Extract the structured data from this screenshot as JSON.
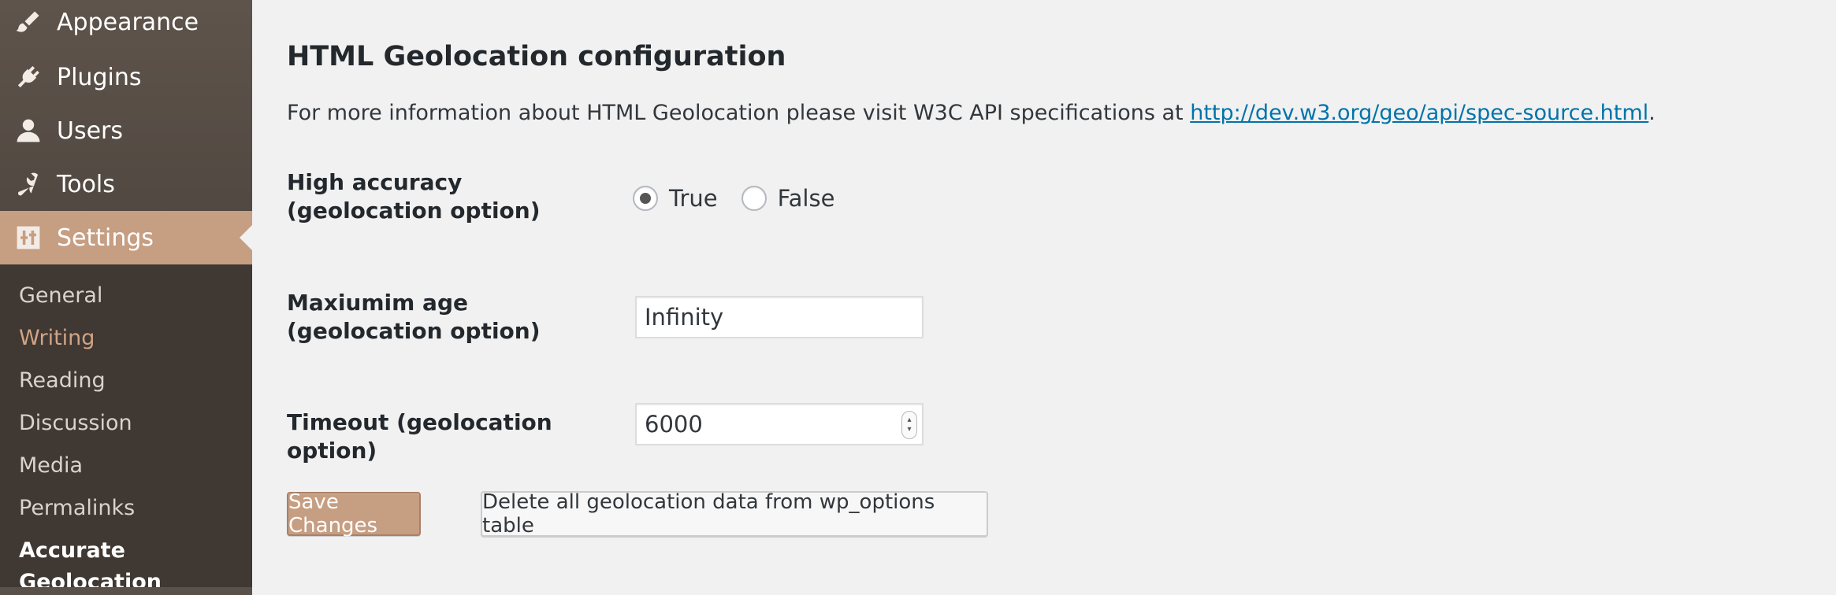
{
  "sidebar": {
    "menu": [
      {
        "label": "Appearance",
        "icon": "paintbrush-icon"
      },
      {
        "label": "Plugins",
        "icon": "plug-icon"
      },
      {
        "label": "Users",
        "icon": "user-icon"
      },
      {
        "label": "Tools",
        "icon": "wrench-icon"
      },
      {
        "label": "Settings",
        "icon": "sliders-icon",
        "active": true
      }
    ],
    "submenu": [
      {
        "label": "General"
      },
      {
        "label": "Writing"
      },
      {
        "label": "Reading"
      },
      {
        "label": "Discussion"
      },
      {
        "label": "Media"
      },
      {
        "label": "Permalinks"
      },
      {
        "label": "Accurate Geolocation",
        "current": true
      }
    ]
  },
  "main": {
    "title": "HTML Geolocation configuration",
    "info_text": "For more information about HTML Geolocation please visit W3C API specifications at",
    "info_link": "http://dev.w3.org/geo/api/spec-source.html",
    "info_suffix": ".",
    "fields": {
      "high_accuracy": {
        "label": "High accuracy (geolocation option)",
        "options": [
          {
            "label": "True",
            "selected": true
          },
          {
            "label": "False",
            "selected": false
          }
        ]
      },
      "maximum_age": {
        "label": "Maxiumim age (geolocation option)",
        "value": "Infinity"
      },
      "timeout": {
        "label": "Timeout (geolocation option)",
        "value": "6000"
      }
    },
    "buttons": {
      "save": "Save Changes",
      "delete": "Delete all geolocation data from wp_options table"
    }
  },
  "colors": {
    "sidebar_bg": "#534a43",
    "accent": "#c69e82",
    "link": "#0073aa",
    "content_bg": "#f1f1f1"
  }
}
